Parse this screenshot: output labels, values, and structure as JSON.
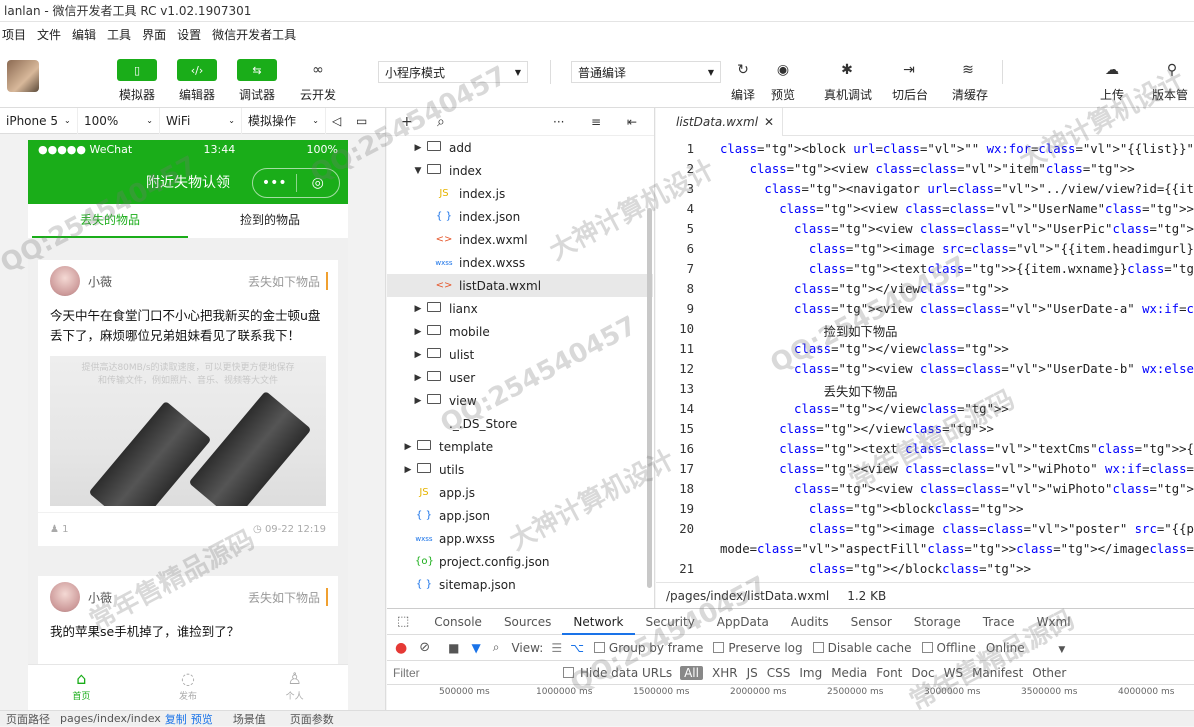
{
  "window": {
    "title": "lanlan - 微信开发者工具 RC v1.02.1907301"
  },
  "menu": [
    "项目",
    "文件",
    "编辑",
    "工具",
    "界面",
    "设置",
    "微信开发者工具"
  ],
  "toolbar": {
    "simulator": "模拟器",
    "editor": "编辑器",
    "debugger": "调试器",
    "cloud": "云开发",
    "mode": "小程序模式",
    "compile_mode": "普通编译",
    "compile": "编译",
    "preview": "预览",
    "real_debug": "真机调试",
    "background": "切后台",
    "clear_cache": "清缓存",
    "upload": "上传",
    "version": "版本管"
  },
  "simbar": {
    "device": "iPhone 5",
    "zoom": "100%",
    "network": "WiFi",
    "ops": "模拟操作"
  },
  "phone": {
    "carrier": "●●●●● WeChat",
    "time": "13:44",
    "battery": "100%",
    "nav_title": "附近失物认领",
    "tabs": [
      "丢失的物品",
      "捡到的物品"
    ],
    "posts": [
      {
        "user": "小薇",
        "tag": "丢失如下物品",
        "content": "今天中午在食堂门口不小心把我新买的金士顿u盘丢下了，麻烦哪位兄弟姐妹看见了联系我下！",
        "photo_text": "提供高达80MB/s的读取速度，可以更快更方便地保存和传输文件，例如照片、音乐、视频等大文件",
        "likes": "1",
        "date": "09-22 12:19"
      },
      {
        "user": "小薇",
        "tag": "丢失如下物品",
        "content": "我的苹果se手机掉了，谁捡到了？"
      }
    ],
    "tabbar": [
      "首页",
      "发布",
      "个人"
    ]
  },
  "statusbar": {
    "path_label": "页面路径",
    "path": "pages/index/index",
    "copy": "复制",
    "preview": "预览",
    "scene": "场景值",
    "params": "页面参数"
  },
  "files": [
    {
      "name": "add",
      "type": "folder",
      "depth": 1,
      "open": false
    },
    {
      "name": "index",
      "type": "folder",
      "depth": 1,
      "open": true
    },
    {
      "name": "index.js",
      "type": "js",
      "depth": 2
    },
    {
      "name": "index.json",
      "type": "json",
      "depth": 2
    },
    {
      "name": "index.wxml",
      "type": "wxml",
      "depth": 2
    },
    {
      "name": "index.wxss",
      "type": "wxss",
      "depth": 2
    },
    {
      "name": "listData.wxml",
      "type": "wxml",
      "depth": 2,
      "selected": true
    },
    {
      "name": "lianx",
      "type": "folder",
      "depth": 1,
      "open": false
    },
    {
      "name": "mobile",
      "type": "folder",
      "depth": 1,
      "open": false
    },
    {
      "name": "ulist",
      "type": "folder",
      "depth": 1,
      "open": false
    },
    {
      "name": "user",
      "type": "folder",
      "depth": 1,
      "open": false
    },
    {
      "name": "view",
      "type": "folder",
      "depth": 1,
      "open": false
    },
    {
      "name": "._.DS_Store",
      "type": "file",
      "depth": 1
    },
    {
      "name": "template",
      "type": "folder",
      "depth": 0,
      "open": false
    },
    {
      "name": "utils",
      "type": "folder",
      "depth": 0,
      "open": false
    },
    {
      "name": "app.js",
      "type": "js",
      "depth": 0
    },
    {
      "name": "app.json",
      "type": "json",
      "depth": 0
    },
    {
      "name": "app.wxss",
      "type": "wxss",
      "depth": 0
    },
    {
      "name": "project.config.json",
      "type": "config",
      "depth": 0
    },
    {
      "name": "sitemap.json",
      "type": "json",
      "depth": 0
    }
  ],
  "editor": {
    "tab": "listData.wxml",
    "file_path": "/pages/index/listData.wxml",
    "file_size": "1.2 KB",
    "lines": [
      {
        "n": "1",
        "code": "<block url=\"\" wx:for=\"{{list}}\" wx:key=\"\">"
      },
      {
        "n": "2",
        "code": "    <view class=\"item\">"
      },
      {
        "n": "3",
        "code": "      <navigator url=\"../view/view?id={{item.id}}\" class=\"navi"
      },
      {
        "n": "4",
        "code": "        <view class=\"UserName\">"
      },
      {
        "n": "5",
        "code": "          <view class=\"UserPic\">"
      },
      {
        "n": "6",
        "code": "            <image src=\"{{item.headimgurl}}\"></image>"
      },
      {
        "n": "7",
        "code": "            <text>{{item.wxname}}</text>"
      },
      {
        "n": "8",
        "code": "          </view>"
      },
      {
        "n": "9",
        "code": "          <view class=\"UserDate-a\" wx:if=\"{{item.rid == 1}}\">"
      },
      {
        "n": "10",
        "code": "              捡到如下物品"
      },
      {
        "n": "11",
        "code": "          </view>"
      },
      {
        "n": "12",
        "code": "          <view class=\"UserDate-b\" wx:else>"
      },
      {
        "n": "13",
        "code": "              丢失如下物品"
      },
      {
        "n": "14",
        "code": "          </view>"
      },
      {
        "n": "15",
        "code": "        </view>"
      },
      {
        "n": "16",
        "code": "        <text class=\"textCms\">{{item.content}}</text>"
      },
      {
        "n": "17",
        "code": "        <view class=\"wiPhoto\" wx:if=\"{{item.photo != null}}\">"
      },
      {
        "n": "18",
        "code": "          <view class=\"wiPhoto\">"
      },
      {
        "n": "19",
        "code": "            <block>"
      },
      {
        "n": "20",
        "code": "            <image class=\"poster\" src=\"{{picUrl}}{{item.phot"
      },
      {
        "n": "",
        "code": "mode=\"aspectFill\"></image>"
      },
      {
        "n": "21",
        "code": "            </block>"
      }
    ]
  },
  "devtools": {
    "tabs": [
      "Console",
      "Sources",
      "Network",
      "Security",
      "AppData",
      "Audits",
      "Sensor",
      "Storage",
      "Trace",
      "Wxml"
    ],
    "active": "Network",
    "view_label": "View:",
    "group_by_frame": "Group by frame",
    "preserve_log": "Preserve log",
    "disable_cache": "Disable cache",
    "offline": "Offline",
    "online": "Online",
    "filter_placeholder": "Filter",
    "hide_data_urls": "Hide data URLs",
    "filters": [
      "All",
      "XHR",
      "JS",
      "CSS",
      "Img",
      "Media",
      "Font",
      "Doc",
      "WS",
      "Manifest",
      "Other"
    ],
    "ruler": [
      "500000 ms",
      "1000000 ms",
      "1500000 ms",
      "2000000 ms",
      "2500000 ms",
      "3000000 ms",
      "3500000 ms",
      "4000000 ms"
    ]
  },
  "watermarks": [
    "QQ:254540457",
    "常年售精品源码",
    "大神计算机设计"
  ],
  "colors": {
    "wechat_green": "#1aad19",
    "accent_blue": "#1a73e8",
    "tag_orange": "#f0a030"
  }
}
